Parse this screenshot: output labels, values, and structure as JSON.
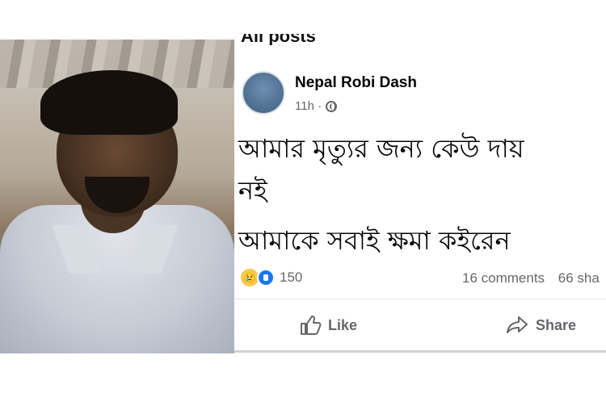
{
  "header": {
    "section_title": "All posts"
  },
  "post": {
    "author": "Nepal Robi Dash",
    "time": "11h ·",
    "text_line_1": "আমার মৃত্যুর জন্য কেউ দায়",
    "text_line_2": "নই",
    "text_line_3": "আমাকে সবাই ক্ষমা কইরেন",
    "reaction_count": "150",
    "comments": "16 comments",
    "shares": "66 sha"
  },
  "actions": {
    "like_label": "Like",
    "share_label": "Share"
  },
  "icons": [
    "globe-icon",
    "sad-reaction-icon",
    "like-reaction-icon",
    "thumbs-up-icon",
    "share-arrow-icon"
  ],
  "colors": {
    "facebook_blue": "#1877f2",
    "meta_gray": "#65676b",
    "text": "#050505"
  }
}
